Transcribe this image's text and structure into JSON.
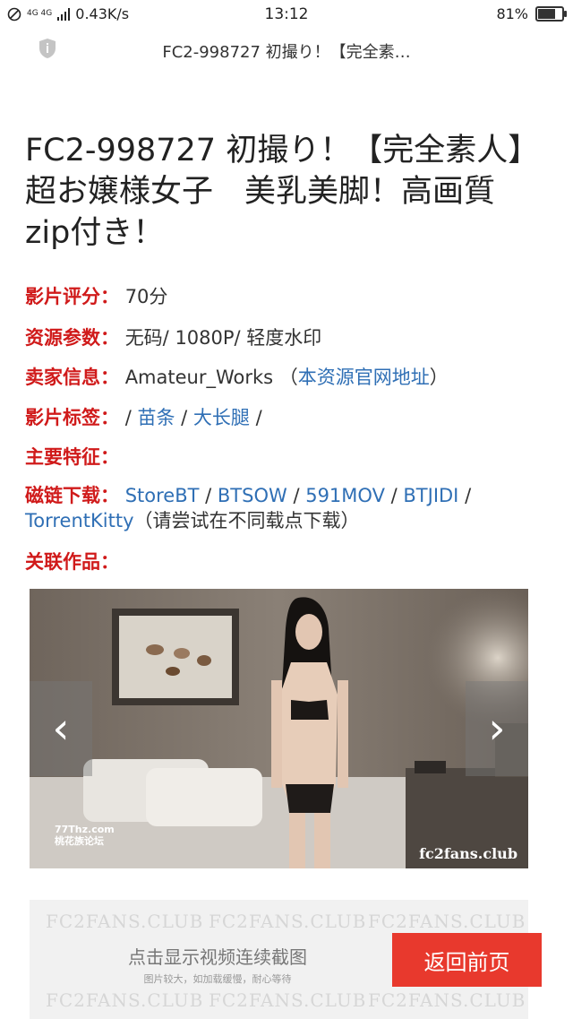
{
  "status_bar": {
    "network": "4G 4G",
    "speed": "0.43K/s",
    "time": "13:12",
    "battery": "81%",
    "battery_level": 0.81
  },
  "address_bar": {
    "title": "FC2-998727 初撮り！【完全素…"
  },
  "page": {
    "title": "FC2-998727 初撮り！【完全素人】超お嬢様女子　美乳美脚！高画質zip付き！",
    "rating": {
      "label": "影片评分",
      "colon": "：",
      "value": "70分"
    },
    "params": {
      "label": "资源参数",
      "colon": "：",
      "value": "无码/ 1080P/ 轻度水印"
    },
    "seller": {
      "label": "卖家信息",
      "colon": "：",
      "value": "Amateur_Works",
      "paren_open": "（",
      "link": "本资源官网地址",
      "paren_close": "）"
    },
    "tags": {
      "label": "影片标签",
      "colon": "：",
      "sep": "/",
      "items": [
        "苗条",
        "大长腿"
      ]
    },
    "features": {
      "label": "主要特征",
      "colon": "："
    },
    "magnet": {
      "label": "磁链下载",
      "colon": "：",
      "links": [
        "StoreBT",
        "BTSOW",
        "591MOV",
        "BTJIDI",
        "TorrentKitty"
      ],
      "note": "（请尝试在不同载点下载）"
    },
    "related": {
      "label": "关联作品",
      "colon": "："
    }
  },
  "carousel": {
    "prev": "‹",
    "next": "›",
    "watermark_left": "77Thz.com",
    "watermark_left_sub": "桃花族论坛",
    "watermark_right": "fc2fans.club"
  },
  "panel": {
    "watermark": "FC2FANS.CLUB",
    "main_text": "点击显示视频连续截图",
    "sub_text": "图片较大，如加载缓慢，耐心等待"
  },
  "back_button": "返回前页",
  "colors": {
    "label_red": "#d01a1a",
    "link_blue": "#2f6fb5",
    "button_red": "#e8392d"
  }
}
